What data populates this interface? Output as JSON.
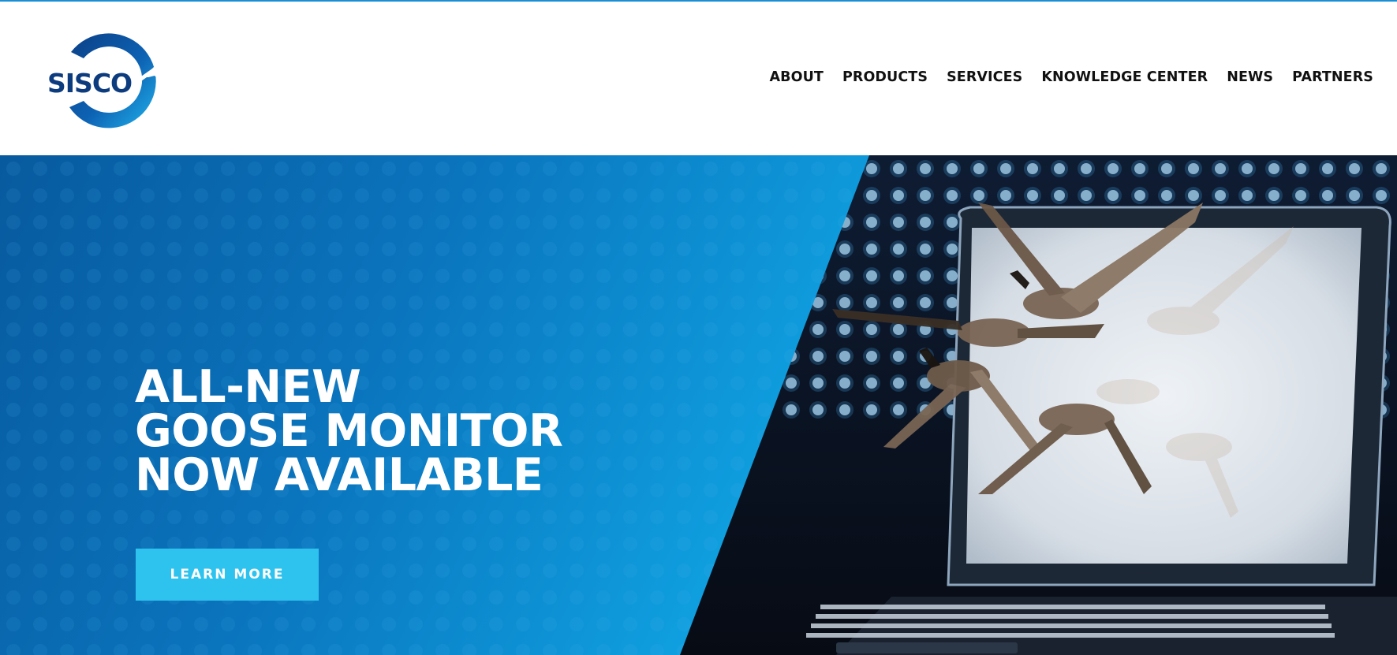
{
  "header": {
    "logo_text": "SISCO",
    "nav": [
      {
        "label": "ABOUT"
      },
      {
        "label": "PRODUCTS"
      },
      {
        "label": "SERVICES"
      },
      {
        "label": "KNOWLEDGE CENTER"
      },
      {
        "label": "NEWS"
      },
      {
        "label": "PARTNERS"
      }
    ]
  },
  "hero": {
    "headline": [
      "ALL-NEW",
      "GOOSE MONITOR",
      "NOW AVAILABLE"
    ],
    "cta_label": "LEARN MORE",
    "image": "geese-flying-out-of-laptop-screen"
  },
  "colors": {
    "accent": "#1a8fd6",
    "brand_dark_blue": "#0d4a8c",
    "hero_blue": "#0a79c4",
    "cta": "#2ec3ee",
    "nav_text": "#111111"
  },
  "icons": {
    "logo": "sisco-circle-arrow-logo"
  }
}
